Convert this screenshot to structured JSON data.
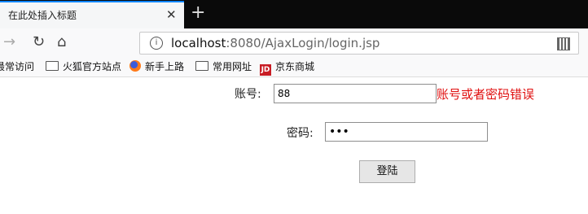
{
  "browser": {
    "tab_title": "在此处插入标题",
    "tab_close": "✕",
    "new_tab": "+",
    "url_host": "localhost",
    "url_rest": ":8080/AjaxLogin/login.jsp",
    "bookmarks": [
      {
        "label": "最常访问",
        "icon": "none"
      },
      {
        "label": "火狐官方站点",
        "icon": "folder-icon"
      },
      {
        "label": "新手上路",
        "icon": "firefox-icon"
      },
      {
        "label": "常用网址",
        "icon": "folder-icon"
      },
      {
        "label": "京东商城",
        "icon": "jd-icon"
      }
    ],
    "jd_badge": "JD"
  },
  "form": {
    "account_label": "账号:",
    "account_value": "88",
    "password_label": "密码:",
    "password_value": "•••",
    "error_message": "账号或者密码错误",
    "submit_label": "登陆"
  },
  "colors": {
    "error": "#e01010",
    "tab_accent": "#0a84ff"
  }
}
